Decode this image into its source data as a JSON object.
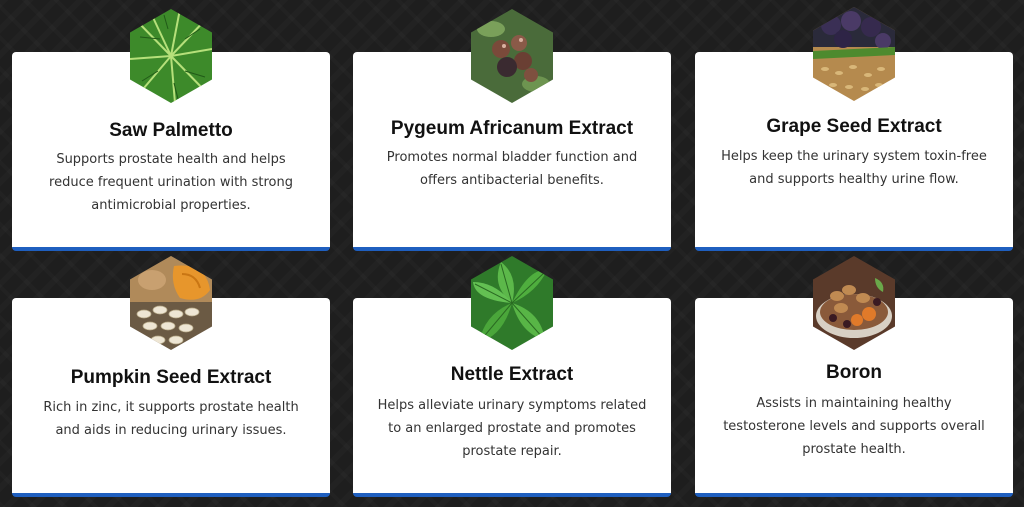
{
  "ingredients": [
    {
      "title": "Saw Palmetto",
      "description": "Supports prostate health and helps reduce frequent urination with strong antimicrobial properties.",
      "image_icon": "palm-leaves-icon"
    },
    {
      "title": "Pygeum Africanum Extract",
      "description": "Promotes normal bladder function and offers antibacterial benefits.",
      "image_icon": "pygeum-berries-icon"
    },
    {
      "title": "Grape Seed Extract",
      "description": "Helps keep the urinary system toxin-free and supports healthy urine flow.",
      "image_icon": "grapes-seeds-icon"
    },
    {
      "title": "Pumpkin Seed Extract",
      "description": "Rich in zinc, it supports prostate health and aids in reducing urinary issues.",
      "image_icon": "pumpkin-seeds-icon"
    },
    {
      "title": "Nettle Extract",
      "description": "Helps alleviate urinary symptoms related to an enlarged prostate and promotes prostate repair.",
      "image_icon": "nettle-leaves-icon"
    },
    {
      "title": "Boron",
      "description": "Assists in maintaining healthy testosterone levels and supports overall prostate health.",
      "image_icon": "nuts-dried-fruit-icon"
    }
  ],
  "colors": {
    "background": "#1e1e1e",
    "card": "#ffffff",
    "card_accent": "#1f5fbf",
    "title_text": "#111111",
    "body_text": "#333333"
  }
}
